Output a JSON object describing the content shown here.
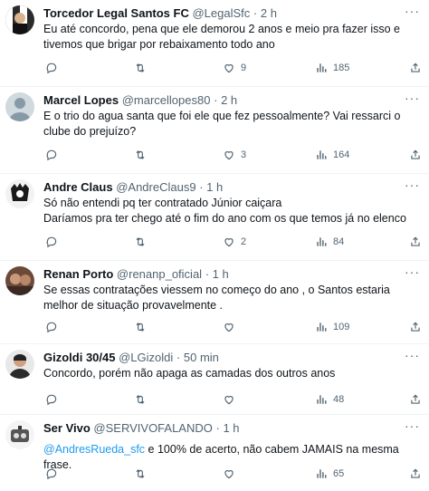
{
  "tweets": [
    {
      "name": "Torcedor Legal Santos FC",
      "handle": "@LegalSfc",
      "dot": "·",
      "time": "2 h",
      "lines": [
        "Eu até concordo, pena que ele demorou 2 anos e meio pra fazer isso e",
        "tivemos que brigar por rebaixamento todo ano"
      ],
      "replies": "",
      "retweets": "",
      "likes": "9",
      "views": "185"
    },
    {
      "name": "Marcel Lopes",
      "handle": "@marcellopes80",
      "dot": "·",
      "time": "2 h",
      "lines": [
        "E o trio do agua santa que foi ele que fez pessoalmente? Vai ressarci o",
        "clube do prejuízo?"
      ],
      "replies": "",
      "retweets": "",
      "likes": "3",
      "views": "164"
    },
    {
      "name": "Andre Claus",
      "handle": "@AndreClaus9",
      "dot": "·",
      "time": "1 h",
      "lines": [
        "Só não entendi pq ter contratado Júnior caiçara",
        "Daríamos pra ter chego até o fim do ano com os que temos já no elenco"
      ],
      "replies": "",
      "retweets": "",
      "likes": "2",
      "views": "84"
    },
    {
      "name": "Renan Porto",
      "handle": "@renanp_oficial",
      "dot": "·",
      "time": "1 h",
      "lines": [
        "Se essas contratações viessem no começo do ano , o Santos estaria",
        "melhor de situação provavelmente ."
      ],
      "replies": "",
      "retweets": "",
      "likes": "",
      "views": "109"
    },
    {
      "name": "Gizoldi 30/45",
      "handle": "@LGizoldi",
      "dot": "·",
      "time": "50 min",
      "lines": [
        "Concordo, porém não apaga as camadas dos outros anos"
      ],
      "replies": "",
      "retweets": "",
      "likes": "",
      "views": "48"
    },
    {
      "name": "Ser Vivo",
      "handle": "@SERVIVOFALANDO",
      "dot": "·",
      "time": "1 h",
      "mention": "@AndresRueda_sfc",
      "lines": [
        " e 100% de acerto, não cabem JAMAIS na mesma frase."
      ],
      "replies": "",
      "retweets": "",
      "likes": "",
      "views": "65"
    }
  ],
  "icons": {
    "reply": "reply-icon",
    "retweet": "retweet-icon",
    "like": "heart-icon",
    "views": "views-icon",
    "share": "share-icon",
    "more": "more-icon"
  },
  "colors": {
    "text": "#0f1419",
    "secondary": "#536471",
    "link": "#1d9bf0",
    "divider": "#eff3f4"
  }
}
